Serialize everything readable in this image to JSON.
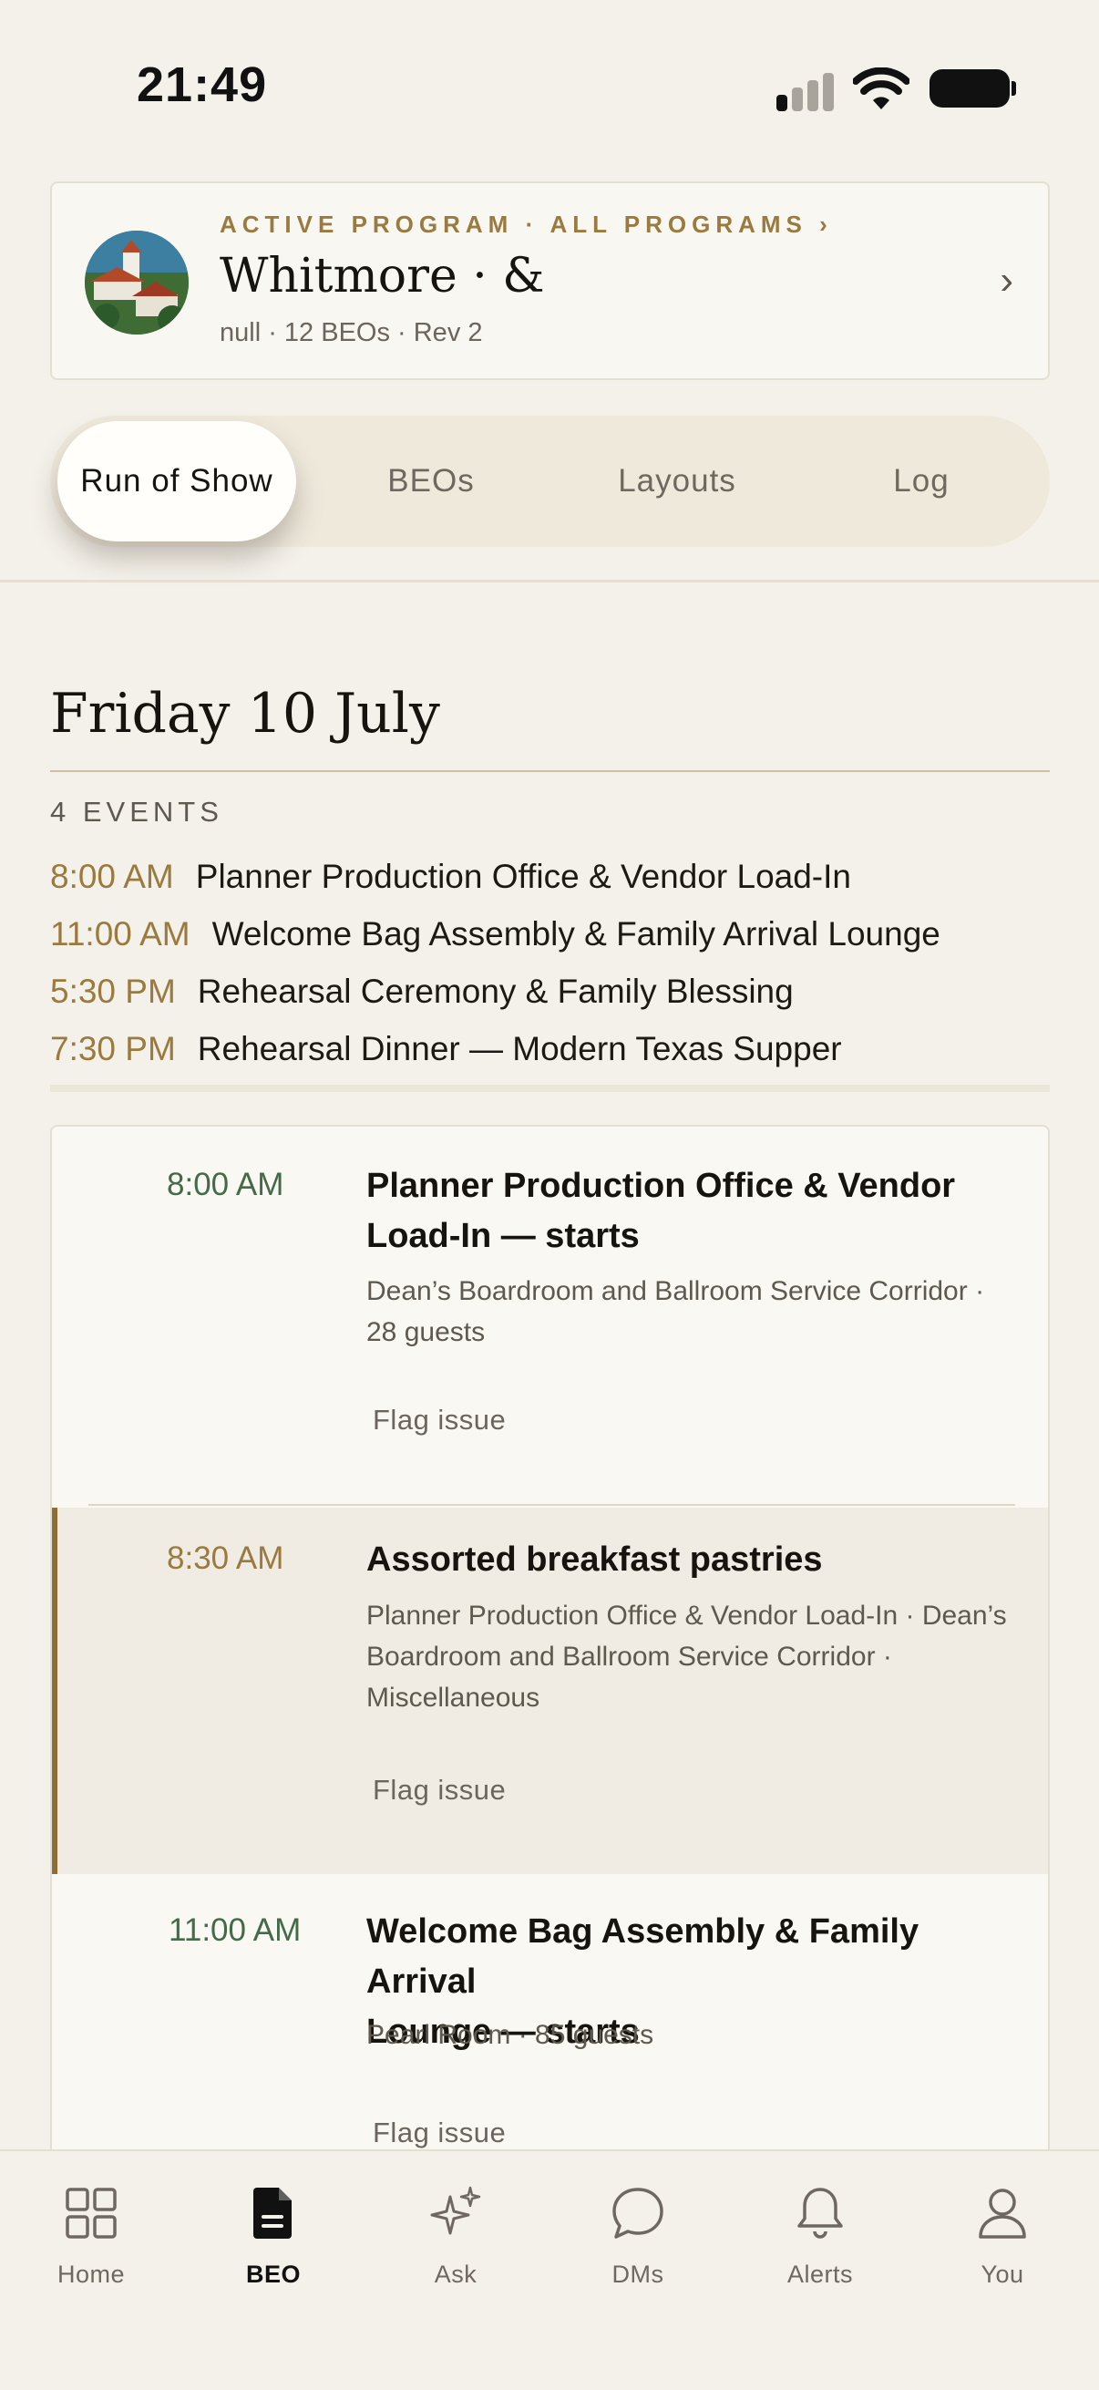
{
  "status_bar": {
    "time": "21:49"
  },
  "program": {
    "eyebrow": "ACTIVE PROGRAM · ALL PROGRAMS ›",
    "title": "Whitmore · &",
    "meta": "null · 12 BEOs · Rev 2",
    "chevron": "›"
  },
  "tabs": [
    {
      "label": "Run of Show",
      "active": true
    },
    {
      "label": "BEOs"
    },
    {
      "label": "Layouts"
    },
    {
      "label": "Log"
    }
  ],
  "day": {
    "title": "Friday 10 July",
    "events_count": "4 EVENTS",
    "summary": [
      {
        "time": "8:00 AM",
        "name": "Planner Production Office & Vendor Load-In"
      },
      {
        "time": "11:00 AM",
        "name": "Welcome Bag Assembly & Family Arrival Lounge"
      },
      {
        "time": "5:30 PM",
        "name": "Rehearsal Ceremony & Family Blessing"
      },
      {
        "time": "7:30 PM",
        "name": "Rehearsal Dinner — Modern Texas Supper"
      }
    ]
  },
  "timeline": [
    {
      "time": "8:00 AM",
      "title_line1": "Planner Production Office & Vendor",
      "title_line2": "Load-In — starts",
      "sub_line1": "Dean’s Boardroom and Ballroom Service Corridor ·",
      "sub_line2": "28 guests",
      "flag": "Flag issue"
    },
    {
      "time": "8:30 AM",
      "title_line1": "Assorted breakfast pastries",
      "sub_line1": "Planner Production Office & Vendor Load-In · Dean’s",
      "sub_line2": "Boardroom and Ballroom Service Corridor ·",
      "sub_line3": "Miscellaneous",
      "flag": "Flag issue"
    },
    {
      "time": "11:00 AM",
      "title_line1": "Welcome Bag Assembly & Family Arrival",
      "title_line2": "Lounge — starts",
      "sub_line1": "Pearl Room · 85 guests",
      "flag": "Flag issue"
    }
  ],
  "nav": [
    {
      "label": "Home",
      "icon": "home-grid-icon"
    },
    {
      "label": "BEO",
      "icon": "document-icon",
      "active": true
    },
    {
      "label": "Ask",
      "icon": "sparkle-icon"
    },
    {
      "label": "DMs",
      "icon": "chat-bubble-icon"
    },
    {
      "label": "Alerts",
      "icon": "bell-icon"
    },
    {
      "label": "You",
      "icon": "person-icon"
    }
  ],
  "colors": {
    "accent_gold": "#9a7a3f",
    "accent_green": "#456a4a",
    "background": "#f4f1ea"
  }
}
